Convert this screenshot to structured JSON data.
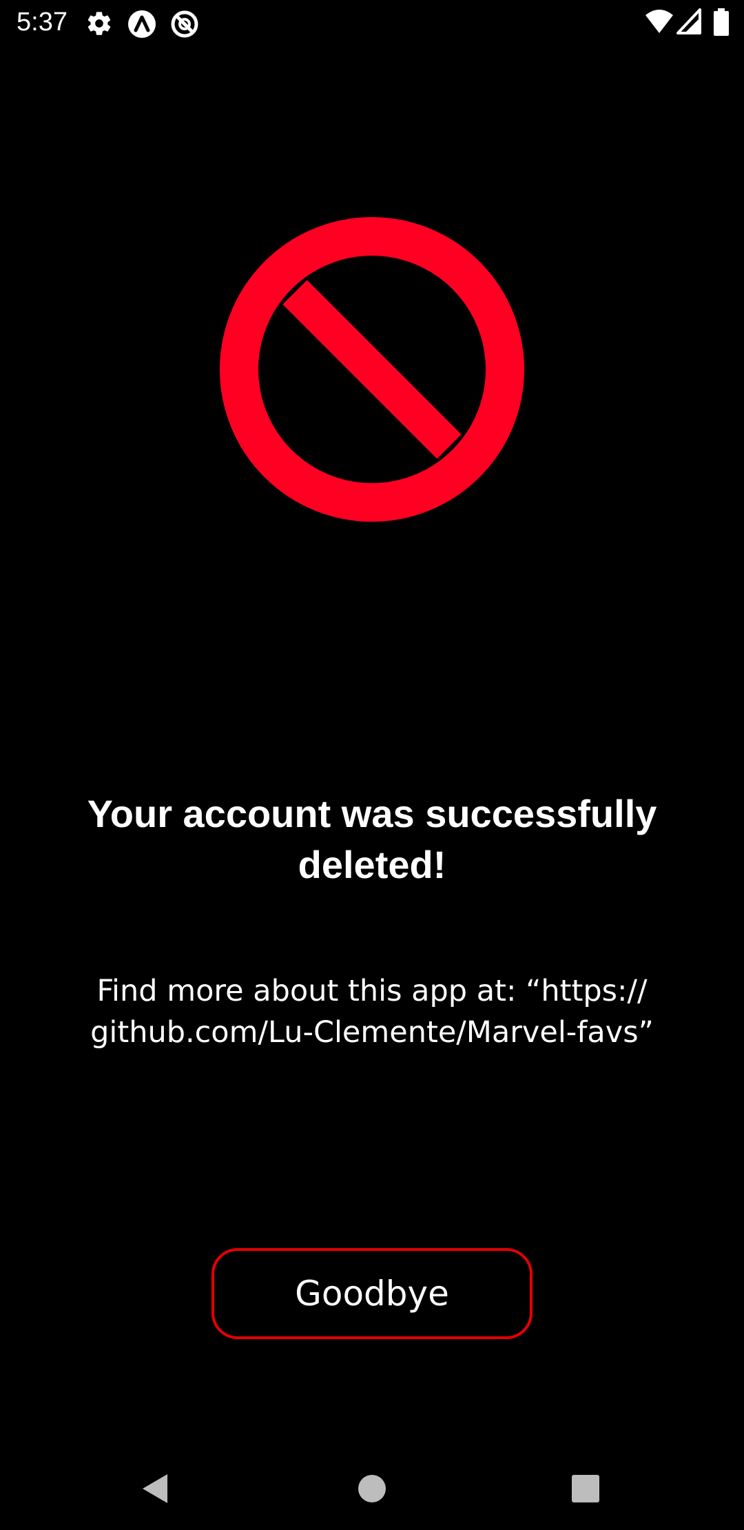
{
  "status_bar": {
    "time": "5:37",
    "left_icons": [
      "settings-gear-icon",
      "app-a-icon",
      "app-q-icon"
    ],
    "right_icons": [
      "wifi-icon",
      "cell-signal-icon",
      "battery-icon"
    ]
  },
  "hero": {
    "icon": "prohibited-icon",
    "color": "#ff0022"
  },
  "content": {
    "headline": "Your account was successfully deleted!",
    "info_text": "Find more about this app at: “https:// github.com/Lu-Clemente/Marvel-favs”"
  },
  "actions": {
    "goodbye_label": "Goodbye",
    "button_border_color": "#e60000"
  },
  "nav_bar": {
    "buttons": [
      "back-icon",
      "home-icon",
      "recents-icon"
    ]
  }
}
